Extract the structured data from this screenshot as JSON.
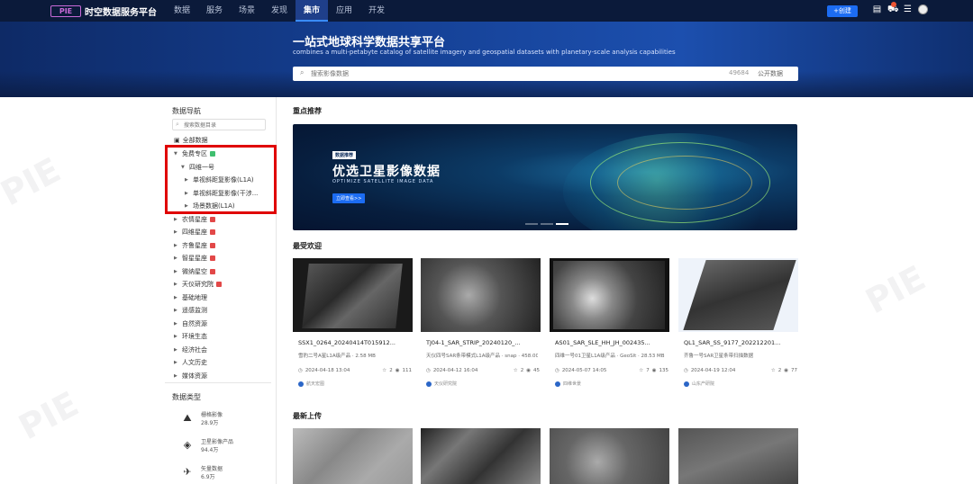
{
  "topbar": {
    "logo_mark": "PIE",
    "logo_text": "时空数据服务平台",
    "nav": [
      "数据",
      "服务",
      "场景",
      "发现",
      "集市",
      "应用",
      "开发"
    ],
    "active_nav": "集市",
    "create_label": "+创建",
    "notif_count": "1"
  },
  "hero": {
    "title": "一站式地球科学数据共享平台",
    "subtitle": "combines a multi-petabyte catalog of satellite imagery and geospatial datasets with planetary-scale analysis capabilities",
    "search_placeholder": "搜索影像数据",
    "search_count": "49684",
    "search_open": "公开数据"
  },
  "sidebar": {
    "title": "数据导航",
    "search_placeholder": "搜索数据目录",
    "all_data": "全部数据",
    "tree": [
      {
        "label": "免费专区",
        "level": 0,
        "caret": "▼",
        "tag": "g"
      },
      {
        "label": "四维一号",
        "level": 1,
        "caret": "▼"
      },
      {
        "label": "单视斜距复影像(L1A)",
        "level": 2,
        "caret": "▶"
      },
      {
        "label": "单视斜距复影像(干涉...",
        "level": 2,
        "caret": "▶"
      },
      {
        "label": "场景数据(L1A)",
        "level": 2,
        "caret": "▶"
      },
      {
        "label": "农情星座",
        "level": 0,
        "caret": "▶",
        "tag": "new"
      },
      {
        "label": "四维星座",
        "level": 0,
        "caret": "▶",
        "tag": "new"
      },
      {
        "label": "齐鲁星座",
        "level": 0,
        "caret": "▶",
        "tag": "new"
      },
      {
        "label": "智星星座",
        "level": 0,
        "caret": "▶",
        "tag": "new"
      },
      {
        "label": "微纳星空",
        "level": 0,
        "caret": "▶",
        "tag": "new"
      },
      {
        "label": "天仪研究院",
        "level": 0,
        "caret": "▶",
        "tag": "new"
      },
      {
        "label": "基础地理",
        "level": 0,
        "caret": "▶"
      },
      {
        "label": "遥感监测",
        "level": 0,
        "caret": "▶"
      },
      {
        "label": "自然资源",
        "level": 0,
        "caret": "▶"
      },
      {
        "label": "环境生态",
        "level": 0,
        "caret": "▶"
      },
      {
        "label": "经济社会",
        "level": 0,
        "caret": "▶"
      },
      {
        "label": "人文历史",
        "level": 0,
        "caret": "▶"
      },
      {
        "label": "媒体资源",
        "level": 0,
        "caret": "▶"
      }
    ],
    "data_types_title": "数据类型",
    "data_types": [
      {
        "icon": "image-icon",
        "name": "栅格影像",
        "count": "28.9万"
      },
      {
        "icon": "layers-icon",
        "name": "卫星影像产品",
        "count": "94.4万"
      },
      {
        "icon": "satellite-icon",
        "name": "矢量数据",
        "count": "6.9万"
      }
    ]
  },
  "main": {
    "featured_title": "重点推荐",
    "banner": {
      "tag": "数据推荐",
      "title": "优选卫星影像数据",
      "en": "OPTIMIZE SATELLITE IMAGE DATA",
      "btn": "立即查看>>"
    },
    "popular_title": "最受欢迎",
    "cards": [
      {
        "title": "SSX1_0264_20240414T015912...",
        "desc": "雪豹二号A星L1A级产品 · 2.58 MB",
        "date": "2024-04-18 13:04",
        "stars": "2",
        "views": "111",
        "org": "航天宏图"
      },
      {
        "title": "TJ04-1_SAR_STRIP_20240120_...",
        "desc": "天仪四号SAR条带模式L1A级产品 · snap · 458.00 MB",
        "date": "2024-04-12 16:04",
        "stars": "2",
        "views": "45",
        "org": "天仪研究院"
      },
      {
        "title": "AS01_SAR_SLE_HH_JH_002435...",
        "desc": "四维一号01卫星L1A级产品 · GeoSlt · 28.53 MB",
        "date": "2024-05-07 14:05",
        "stars": "7",
        "views": "135",
        "org": "四维世景"
      },
      {
        "title": "QL1_SAR_SS_9177_202212201...",
        "desc": "齐鲁一号SAR卫星条带扫描数据",
        "date": "2024-04-19 12:04",
        "stars": "2",
        "views": "77",
        "org": "山东产研院"
      }
    ],
    "latest_title": "最新上传"
  }
}
